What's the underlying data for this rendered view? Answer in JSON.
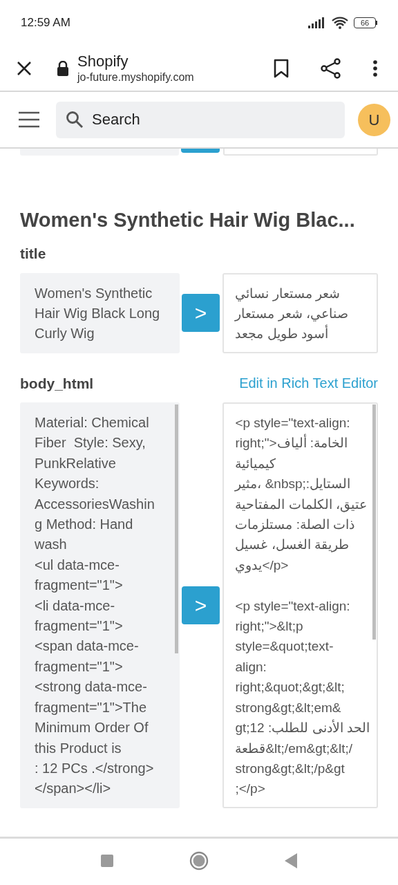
{
  "status_bar": {
    "time": "12:59 AM",
    "battery": "66"
  },
  "browser_bar": {
    "title": "Shopify",
    "url": "jo-future.myshopify.com"
  },
  "app_header": {
    "search": {
      "placeholder": "Search"
    },
    "avatar": "U"
  },
  "product_title": "Women's Synthetic Hair Wig Blac...",
  "fields": [
    {
      "label": "title",
      "source": "Women's Synthetic\nHair Wig Black Long\nCurly Wig",
      "translate_button": ">",
      "target": "شعر مستعار نسائي\nصناعي، شعر مستعار\nأسود طويل مجعد"
    },
    {
      "label": "body_html",
      "link": "Edit in Rich Text Editor",
      "source": "Material: Chemical\nFiber  Style: Sexy,\nPunkRelative\nKeywords:\nAccessoriesWashin\ng Method: Hand\nwash\n<ul data-mce-\nfragment=\"1\">\n<li data-mce-\nfragment=\"1\">\n<span data-mce-\nfragment=\"1\">\n<strong data-mce-\nfragment=\"1\">The\nMinimum Order Of\nthis Product is\n: 12 PCs .</strong>\n</span></li>",
      "translate_button": ">",
      "target": "<p style=\"text-align:\nright;\">الخامة: ألياف\nكيميائية\nمثير، &nbsp;:الستايل\nعتيق، الكلمات المفتاحية\nذات الصلة: مستلزمات\nطريقة الغسل، غسيل\nيدوي</p>\n\n<p style=\"text-align:\nright;\">&lt;p\nstyle=&quot;text-\nalign:\nright;&quot;&gt;&lt;\nstrong&gt;&lt;em&\ngt;12 :الحد الأدنى للطلب\nقطعة&lt;/em&gt;&lt;/\nstrong&gt;&lt;/p&gt\n;</p>"
    }
  ]
}
